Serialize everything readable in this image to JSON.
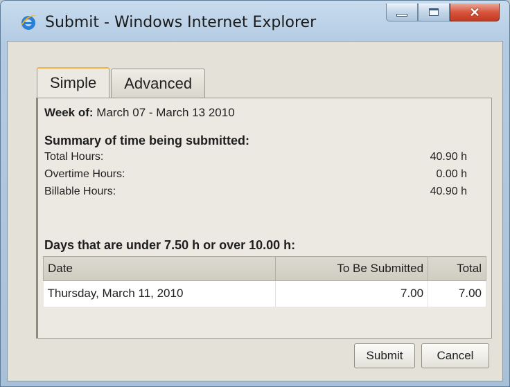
{
  "window": {
    "title": "Submit - Windows Internet Explorer",
    "icon": "internet-explorer-icon",
    "buttons": {
      "minimize": "minimize-icon",
      "maximize": "maximize-icon",
      "close": "✕"
    }
  },
  "tabs": [
    {
      "label": "Simple",
      "active": true
    },
    {
      "label": "Advanced",
      "active": false
    }
  ],
  "week": {
    "label": "Week of:",
    "value": "March 07 - March 13 2010"
  },
  "summary": {
    "heading": "Summary of time being submitted:",
    "rows": [
      {
        "label": "Total Hours:",
        "value": "40.90 h"
      },
      {
        "label": "Overtime Hours:",
        "value": "0.00 h"
      },
      {
        "label": "Billable Hours:",
        "value": "40.90 h"
      }
    ]
  },
  "days": {
    "heading": "Days that are under 7.50 h or over 10.00 h:",
    "columns": [
      "Date",
      "To Be Submitted",
      "Total"
    ],
    "rows": [
      {
        "date": "Thursday, March 11, 2010",
        "to_be_submitted": "7.00",
        "total": "7.00"
      }
    ]
  },
  "actions": {
    "submit": "Submit",
    "cancel": "Cancel"
  },
  "colors": {
    "active_tab_accent": "#f3b23c",
    "panel_background": "#ebe9e1"
  }
}
